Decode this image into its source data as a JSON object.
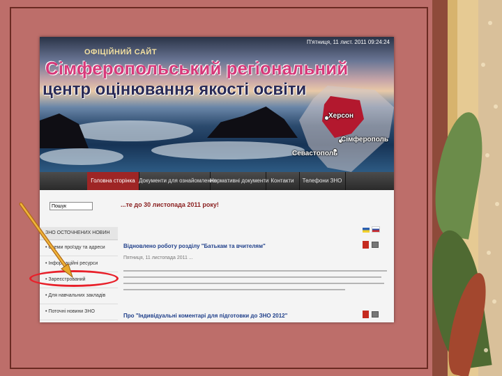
{
  "banner": {
    "date_text": "П'ятниця, 11 лист. 2011 09:24:24",
    "official_label": "ОФІЦІЙНИЙ САЙТ",
    "title_line1": "Сімферопольський регіональний",
    "title_line2": "центр оцінювання якості освіти",
    "cities": [
      "Херсон",
      "Сімферополь",
      "Севастополь"
    ]
  },
  "nav": {
    "items": [
      {
        "label": "Головна сторінка",
        "active": true
      },
      {
        "label": "Документи для ознайомлення",
        "active": false
      },
      {
        "label": "Нормативні документи",
        "active": false
      },
      {
        "label": "Контакти",
        "active": false
      },
      {
        "label": "Телефони ЗНО",
        "active": false
      }
    ]
  },
  "search": {
    "value": "Пошук"
  },
  "notice": "...те до 30 листопада 2011 року!",
  "sidebar": {
    "heading": "ЗНО ОСТОЧНЕНИХ НОВИН",
    "items": [
      "Схеми проїзду та адреси",
      "Інформаційні ресурси",
      "Зареєстрований",
      "Для навчальних закладів",
      "Поточні новини ЗНО"
    ]
  },
  "articles": [
    {
      "title": "Відновлено роботу розділу \"Батькам та вчителям\""
    },
    {
      "title": "Про \"Індивідуальні коментарі для підготовки до ЗНО 2012\""
    }
  ],
  "article_date": "Пятниця, 11 листопада 2011 ...",
  "colors": {
    "accent_red": "#9e2525",
    "annotation_red": "#e8202a",
    "arrow_gold": "#d79b22",
    "slide_bg": "#bd6e6a"
  }
}
